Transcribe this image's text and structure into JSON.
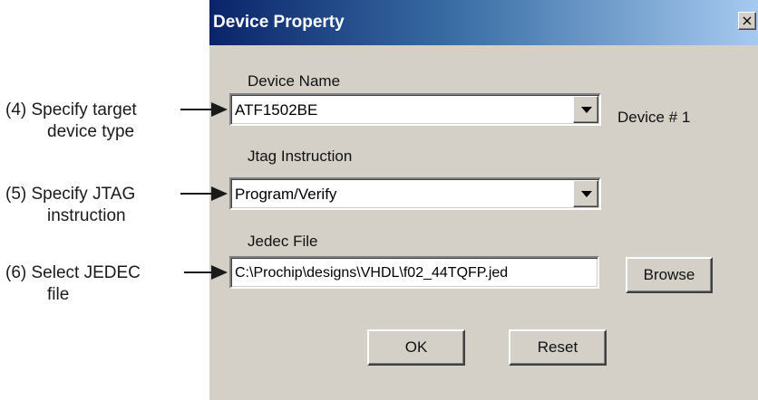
{
  "callouts": [
    {
      "line1": "(4) Specify target",
      "line2": "device type"
    },
    {
      "line1": "(5) Specify JTAG",
      "line2": "instruction"
    },
    {
      "line1": "(6) Select JEDEC",
      "line2": "file"
    }
  ],
  "dialog": {
    "title": "Device Property",
    "close_glyph": "×",
    "device_name": {
      "label": "Device Name",
      "value": "ATF1502BE"
    },
    "device_number": "Device # 1",
    "jtag_instruction": {
      "label": "Jtag Instruction",
      "value": "Program/Verify"
    },
    "jedec_file": {
      "label": "Jedec File",
      "value": "C:\\Prochip\\designs\\VHDL\\f02_44TQFP.jed"
    },
    "browse_label": "Browse",
    "ok_label": "OK",
    "reset_label": "Reset"
  },
  "colors": {
    "titlebar_start": "#0a246a",
    "titlebar_end": "#a6caf0",
    "dialog_face": "#d4d0c8"
  },
  "icons": [
    "close-icon",
    "chevron-down-icon",
    "arrow-right-icon"
  ]
}
